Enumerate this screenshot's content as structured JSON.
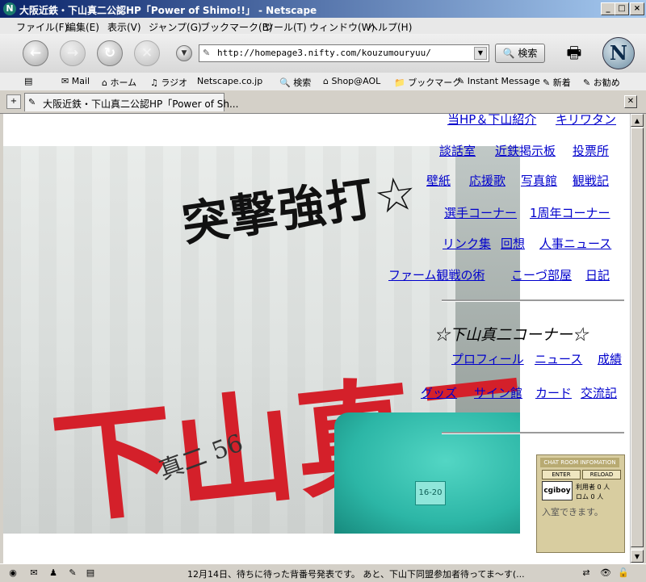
{
  "window": {
    "title": "大阪近鉄・下山真二公認HP「Power of Shimo!!」 - Netscape",
    "app_icon": "N",
    "controls": [
      "_",
      "□",
      "×"
    ]
  },
  "menu": [
    "ファイル(F)",
    "編集(E)",
    "表示(V)",
    "ジャンプ(G)",
    "ブックマーク(B)",
    "ツール(T)",
    "ウィンドウ(W)",
    "ヘルプ(H)"
  ],
  "nav": {
    "url": "http://homepage3.nifty.com/kouzumouryuu/",
    "search_label": "検索",
    "logo_letter": "N"
  },
  "personal_toolbar": [
    "Mail",
    "ホーム",
    "ラジオ",
    "Netscape.co.jp",
    "検索",
    "Shop@AOL",
    "ブックマーク",
    "Instant Message",
    "新着",
    "お勧め"
  ],
  "tab": {
    "label": "大阪近鉄・下山真二公認HP「Power of Sh..."
  },
  "banner": {
    "slogan": "突撃強打☆",
    "name": "下山真二",
    "signature": "真二 56",
    "seat_tag": "16-20"
  },
  "links": {
    "row0": [
      "当HP＆下山紹介",
      "キリワタン"
    ],
    "row1": [
      "談話室",
      "近鉄掲示板",
      "投票所"
    ],
    "row2": [
      "壁紙",
      "応援歌",
      "写真館",
      "観戦記"
    ],
    "row3": [
      "選手コーナー",
      "1周年コーナー"
    ],
    "row4": [
      "リンク集",
      "回想",
      "人事ニュース"
    ],
    "row5": [
      "ファーム観戦の術",
      "こーづ部屋",
      "日記"
    ],
    "corner_title": "☆下山真二コーナー☆",
    "row6": [
      "プロフィール",
      "ニュース",
      "成績"
    ],
    "row7": [
      "グッズ",
      "サイン館",
      "カード",
      "交流記"
    ]
  },
  "chat": {
    "title": "CHAT ROOM INFOMATION",
    "enter": "ENTER",
    "reload": "RELOAD",
    "logo": "cgiboy",
    "users_label": "利用者",
    "users_count": "0",
    "users_unit": "人",
    "rom_label": "ロム",
    "rom_count": "0",
    "rom_unit": "人",
    "status": "入室できます。"
  },
  "status": {
    "message": "12月14日、待ちに待った背番号発表です。 あと、下山下同盟参加者待ってま～す(..."
  },
  "colors": {
    "title_bar": "#0a246a",
    "link": "#0000cc",
    "banner_red": "#d4202a",
    "seat_teal": "#2cb6a6"
  }
}
